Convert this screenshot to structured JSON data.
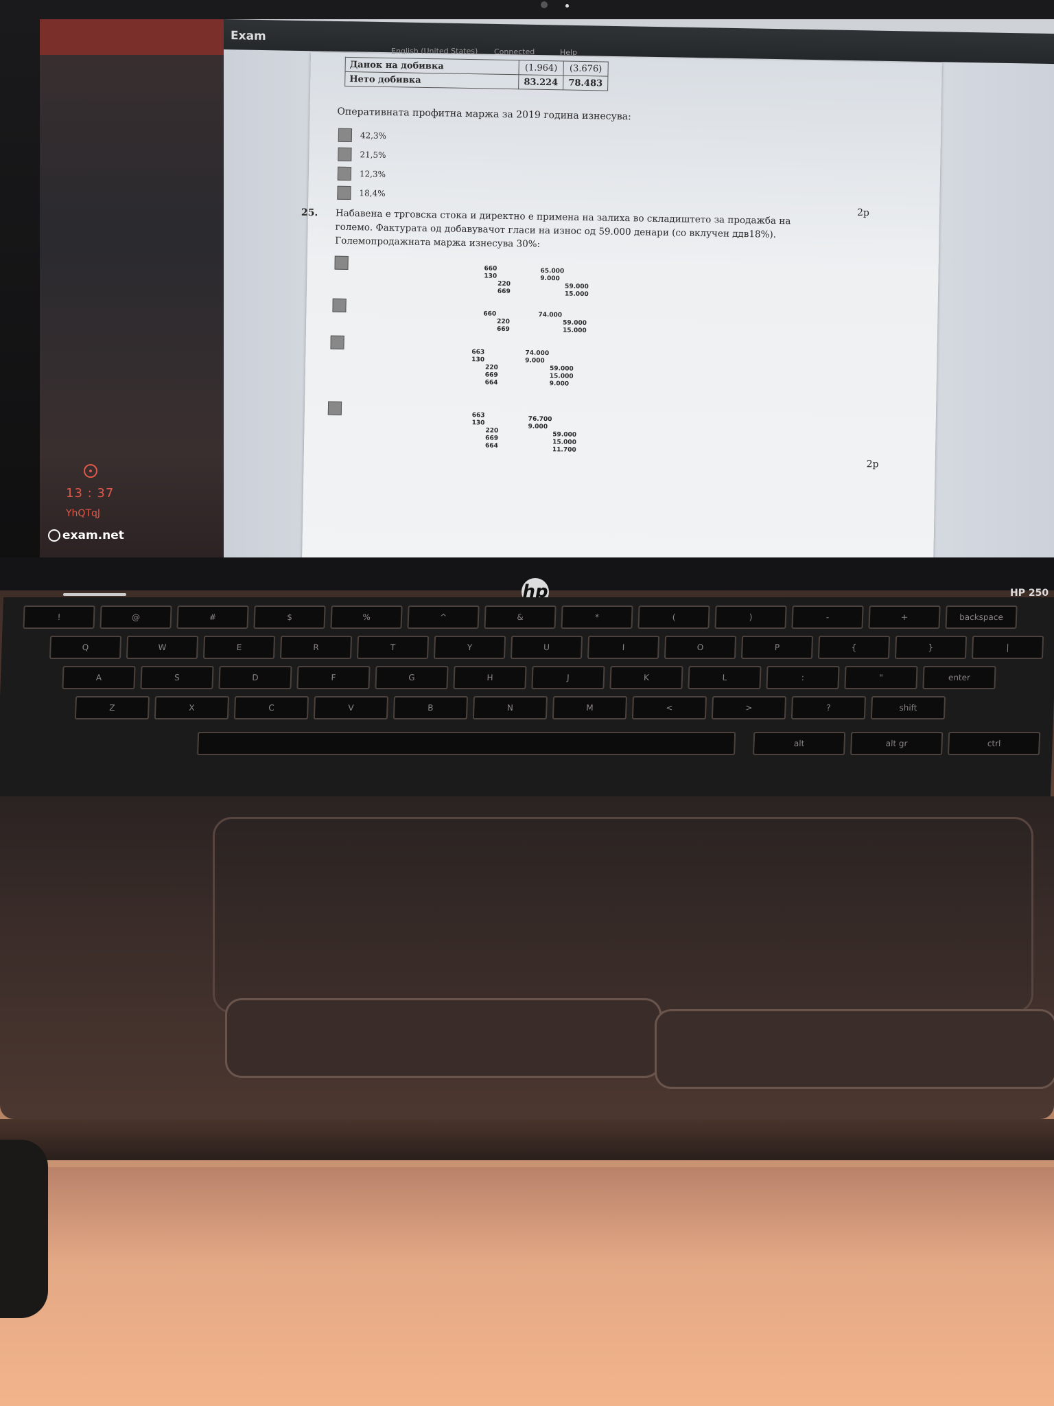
{
  "exam_app": {
    "title": "Exam",
    "language": "English (United States)",
    "connection": "Connected",
    "help": "Help",
    "sidebar": {
      "timer": "13 : 37",
      "code": "YhQTqJ",
      "brand": "exam.net"
    }
  },
  "document": {
    "table": [
      {
        "label": "Данок на добивка",
        "v1": "(1.964)",
        "v2": "(3.676)"
      },
      {
        "label": "Нето добивка",
        "v1": "83.224",
        "v2": "78.483"
      }
    ],
    "question24": {
      "text": "Оперативната профитна маржа за 2019 година изнесува:",
      "options": [
        "42,3%",
        "21,5%",
        "12,3%",
        "18,4%"
      ],
      "points": "2p"
    },
    "question25": {
      "number": "25.",
      "text": "Набавена е трговска стока и директно е примена на залиха во складиштето за продажба на големо. Фактурата од добавувачот гласи на износ од 59.000 денари (со вклучен ддв18%). Големопродажната маржа изнесува 30%:",
      "options": [
        {
          "left": [
            "660",
            "130",
            "220",
            "669"
          ],
          "right": [
            "65.000",
            "9.000",
            "59.000",
            "15.000"
          ]
        },
        {
          "left": [
            "660",
            "220",
            "669"
          ],
          "right": [
            "74.000",
            "59.000",
            "15.000"
          ]
        },
        {
          "left": [
            "663",
            "130",
            "220",
            "669",
            "664"
          ],
          "right": [
            "74.000",
            "9.000",
            "59.000",
            "15.000",
            "9.000"
          ]
        },
        {
          "left": [
            "663",
            "130",
            "220",
            "669",
            "664"
          ],
          "right": [
            "76.700",
            "9.000",
            "59.000",
            "15.000",
            "11.700"
          ]
        }
      ],
      "points": "2p"
    }
  },
  "laptop": {
    "logo": "hp",
    "model": "HP 250"
  },
  "keyboard": {
    "row1": [
      "!",
      "@",
      "#",
      "$",
      "%",
      "^",
      "&",
      "*",
      "(",
      ")",
      "-",
      "+",
      "backspace"
    ],
    "row2": [
      "Q",
      "W",
      "E",
      "R",
      "T",
      "Y",
      "U",
      "I",
      "O",
      "P",
      "{",
      "}",
      "|"
    ],
    "row3": [
      "A",
      "S",
      "D",
      "F",
      "G",
      "H",
      "J",
      "K",
      "L",
      ":",
      "\"",
      "enter"
    ],
    "row4": [
      "Z",
      "X",
      "C",
      "V",
      "B",
      "N",
      "M",
      "<",
      ">",
      "?",
      "shift"
    ],
    "row5": [
      "alt",
      "alt gr",
      "ctrl"
    ]
  }
}
